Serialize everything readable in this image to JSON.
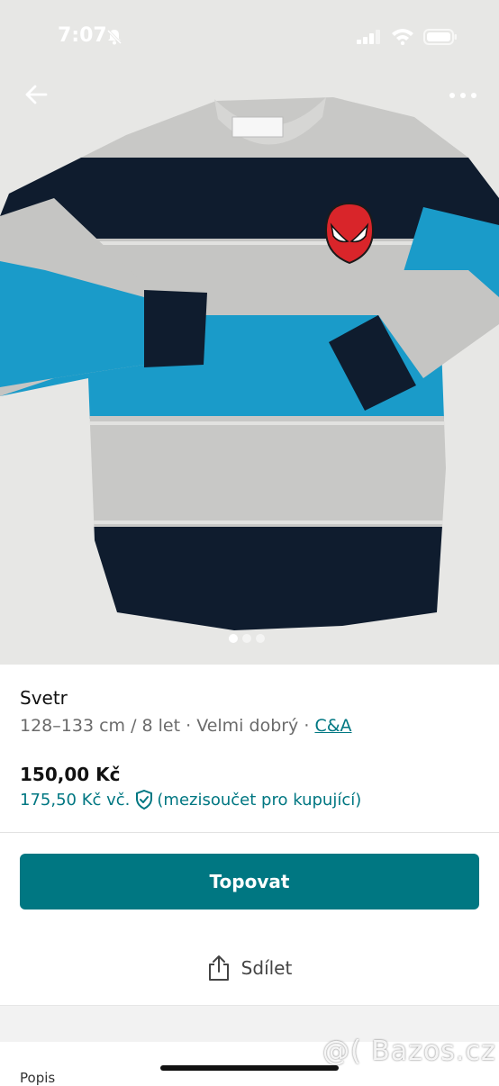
{
  "status_bar": {
    "time": "7:07"
  },
  "gallery": {
    "image_count": 3,
    "active_index": 0
  },
  "item": {
    "title": "Svetr",
    "size": "128–133 cm / 8 let",
    "separator": " · ",
    "condition": "Velmi dobrý",
    "brand": "C&A",
    "price": "150,00 Kč",
    "price_with_fee": "175,50 Kč vč.",
    "fee_note": "(mezisoučet pro kupující)"
  },
  "actions": {
    "promote_label": "Topovat",
    "share_label": "Sdílet"
  },
  "footer": {
    "partial_label": "Popis"
  },
  "watermark": "@( Bazos.cz",
  "colors": {
    "accent": "#007782",
    "navy": "#0f1c2e",
    "blue": "#1a9bc9",
    "gray": "#c9c9c7"
  }
}
